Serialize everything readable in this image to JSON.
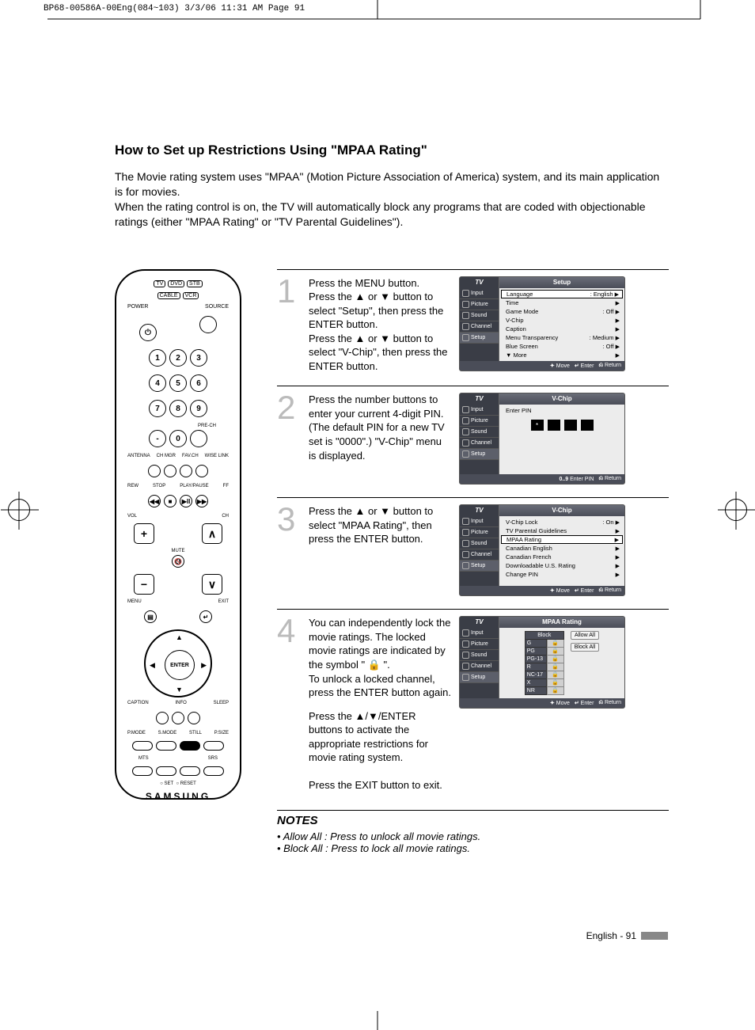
{
  "crop_header": "BP68-00586A-00Eng(084~103)  3/3/06  11:31 AM  Page 91",
  "title": "How to Set up Restrictions Using \"MPAA Rating\"",
  "intro": "The Movie rating system uses \"MPAA\" (Motion Picture Association of America) system, and its main application is for movies.\nWhen the rating control is on, the TV will automatically block any programs that are coded with objectionable ratings (either \"MPAA Rating\" or \"TV Parental Guidelines\").",
  "remote": {
    "sources_row1": [
      "TV",
      "DVD",
      "STB"
    ],
    "sources_row2": [
      "CABLE",
      "VCR"
    ],
    "power": "POWER",
    "source": "SOURCE",
    "digits": [
      "1",
      "2",
      "3",
      "4",
      "5",
      "6",
      "7",
      "8",
      "9",
      "-",
      "0"
    ],
    "prech": "PRE-CH",
    "row_small": [
      "ANTENNA",
      "CH MGR",
      "FAV.CH",
      "WISE LINK"
    ],
    "transport": [
      "REW",
      "STOP",
      "PLAY/PAUSE",
      "FF"
    ],
    "vol": "VOL",
    "mute": "MUTE",
    "ch": "CH",
    "menu": "MENU",
    "exit": "EXIT",
    "enter": "ENTER",
    "caption": "CAPTION",
    "info": "INFO",
    "sleep": "SLEEP",
    "row_modes": [
      "P.MODE",
      "S.MODE",
      "STILL",
      "P.SIZE"
    ],
    "row_audio": [
      "MTS",
      "SRS"
    ],
    "row_set": [
      "SET",
      "RESET"
    ],
    "brand": "SAMSUNG"
  },
  "steps": [
    {
      "num": "1",
      "text": "Press the MENU button.\nPress the ▲ or ▼ button to select \"Setup\", then press the ENTER button.\nPress the ▲ or ▼ button to select \"V-Chip\", then press the ENTER button."
    },
    {
      "num": "2",
      "text": "Press the number buttons to enter your current 4-digit PIN. (The default PIN for a new TV set is \"0000\".) \"V-Chip\" menu is displayed."
    },
    {
      "num": "3",
      "text": "Press the ▲ or ▼ button to select \"MPAA Rating\", then press the ENTER button."
    },
    {
      "num": "4",
      "text": "You can independently lock the movie ratings. The locked movie ratings are indicated by the symbol \" 🔒 \".\nTo unlock a locked channel, press the ENTER button again.",
      "extra": "Press the ▲/▼/ENTER buttons to activate the appropriate restrictions for movie rating system.\n\nPress the EXIT button to exit."
    }
  ],
  "osd": {
    "side": [
      "Input",
      "Picture",
      "Sound",
      "Channel",
      "Setup"
    ],
    "setup": {
      "title": "Setup",
      "rows": [
        {
          "k": "Language",
          "v": ": English"
        },
        {
          "k": "Time",
          "v": ""
        },
        {
          "k": "Game Mode",
          "v": ": Off"
        },
        {
          "k": "V-Chip",
          "v": ""
        },
        {
          "k": "Caption",
          "v": ""
        },
        {
          "k": "Menu Transparency",
          "v": ": Medium"
        },
        {
          "k": "Blue Screen",
          "v": ": Off"
        },
        {
          "k": "▼ More",
          "v": ""
        }
      ],
      "foot": [
        "Move",
        "Enter",
        "Return"
      ]
    },
    "pin": {
      "title": "V-Chip",
      "label": "Enter PIN",
      "foot": [
        "Enter PIN",
        "Return"
      ]
    },
    "vchip": {
      "title": "V-Chip",
      "rows": [
        {
          "k": "V-Chip Lock",
          "v": ": On"
        },
        {
          "k": "TV Parental Guidelines",
          "v": ""
        },
        {
          "k": "MPAA Rating",
          "v": "",
          "sel": true
        },
        {
          "k": "Canadian English",
          "v": ""
        },
        {
          "k": "Canadian French",
          "v": ""
        },
        {
          "k": "Downloadable U.S. Rating",
          "v": ""
        },
        {
          "k": "Change PIN",
          "v": ""
        }
      ],
      "foot": [
        "Move",
        "Enter",
        "Return"
      ]
    },
    "mpaa": {
      "title": "MPAA Rating",
      "block": "Block",
      "ratings": [
        "G",
        "PG",
        "PG-13",
        "R",
        "NC-17",
        "X",
        "NR"
      ],
      "buttons": [
        "Allow All",
        "Block All"
      ],
      "foot": [
        "Move",
        "Enter",
        "Return"
      ]
    }
  },
  "notes": {
    "title": "NOTES",
    "items": [
      "Allow All : Press to unlock all movie ratings.",
      "Block All : Press to lock all movie ratings."
    ]
  },
  "footer": "English - 91"
}
